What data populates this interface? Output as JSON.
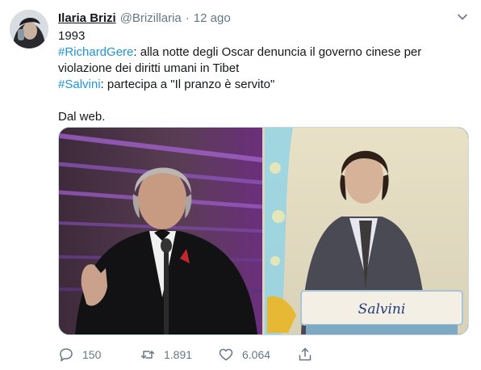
{
  "tweet": {
    "author_name": "Ilaria Brizi",
    "author_handle": "@Brizillaria",
    "separator": "·",
    "timestamp": "12 ago",
    "lines": {
      "l1": "1993",
      "hashtag1": "#RichardGere",
      "l2_rest": ": alla notte degli Oscar denuncia il governo cinese per",
      "l3": "violazione dei diritti umani in Tibet",
      "hashtag2": "#Salvini",
      "l4_rest": ": partecipa a \"Il pranzo è servito\"",
      "l5": "Dal web."
    },
    "media": {
      "nameplate": "Salvini"
    },
    "actions": {
      "reply_count": "150",
      "retweet_count": "1.891",
      "like_count": "6.064"
    }
  },
  "colors": {
    "link": "#1b95e0",
    "muted": "#657786",
    "text": "#14171a"
  },
  "icons": [
    "avatar",
    "chevron-down-icon",
    "reply-icon",
    "retweet-icon",
    "like-icon",
    "share-icon"
  ]
}
